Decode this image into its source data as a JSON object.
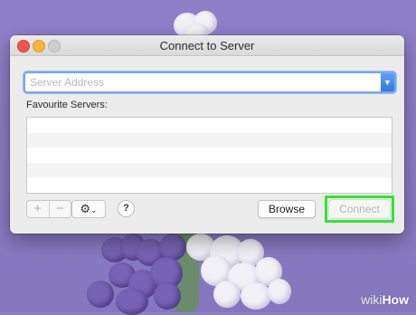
{
  "window": {
    "title": "Connect to Server"
  },
  "server_address": {
    "value": "",
    "placeholder": "Server Address"
  },
  "favourites": {
    "label": "Favourite Servers:",
    "items": []
  },
  "toolbar": {
    "add_symbol": "+",
    "remove_symbol": "−",
    "action_icon": "gear-icon",
    "help_label": "?"
  },
  "buttons": {
    "browse": "Browse",
    "connect": "Connect",
    "connect_enabled": false
  },
  "highlight": {
    "target": "connect-button",
    "color": "#2ee72e"
  },
  "watermark": {
    "part1": "wiki",
    "part2": "How"
  },
  "colors": {
    "accent": "#2f78e6",
    "desktop": "#8a7cc6"
  }
}
